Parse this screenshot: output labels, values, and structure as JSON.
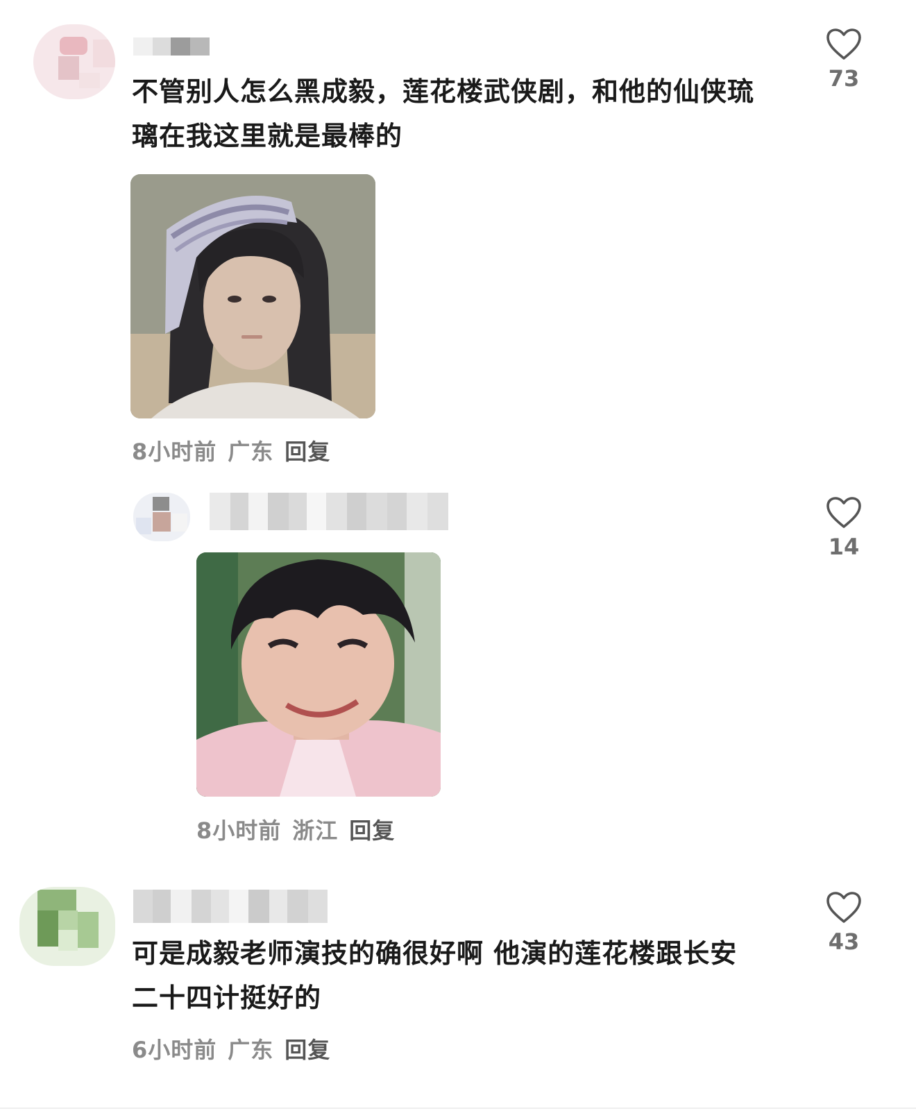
{
  "comments": [
    {
      "text_line1": "不管别人怎么黑成毅，莲花楼武侠剧，和他的仙侠琉",
      "text_line2": "璃在我这里就是最棒的",
      "time": "8小时前",
      "location": "广东",
      "reply_label": "回复",
      "likes": "73"
    },
    {
      "time": "8小时前",
      "location": "浙江",
      "reply_label": "回复",
      "likes": "14"
    },
    {
      "text_line1": "可是成毅老师演技的确很好啊 他演的莲花楼跟长安",
      "text_line2": "二十四计挺好的",
      "time": "6小时前",
      "location": "广东",
      "reply_label": "回复",
      "likes": "43"
    }
  ],
  "icons": {
    "like": "heart-outline-icon"
  },
  "colors": {
    "meta_text": "#8a8a8a",
    "body_text": "#1a1a1a",
    "icon_stroke": "#555555"
  }
}
